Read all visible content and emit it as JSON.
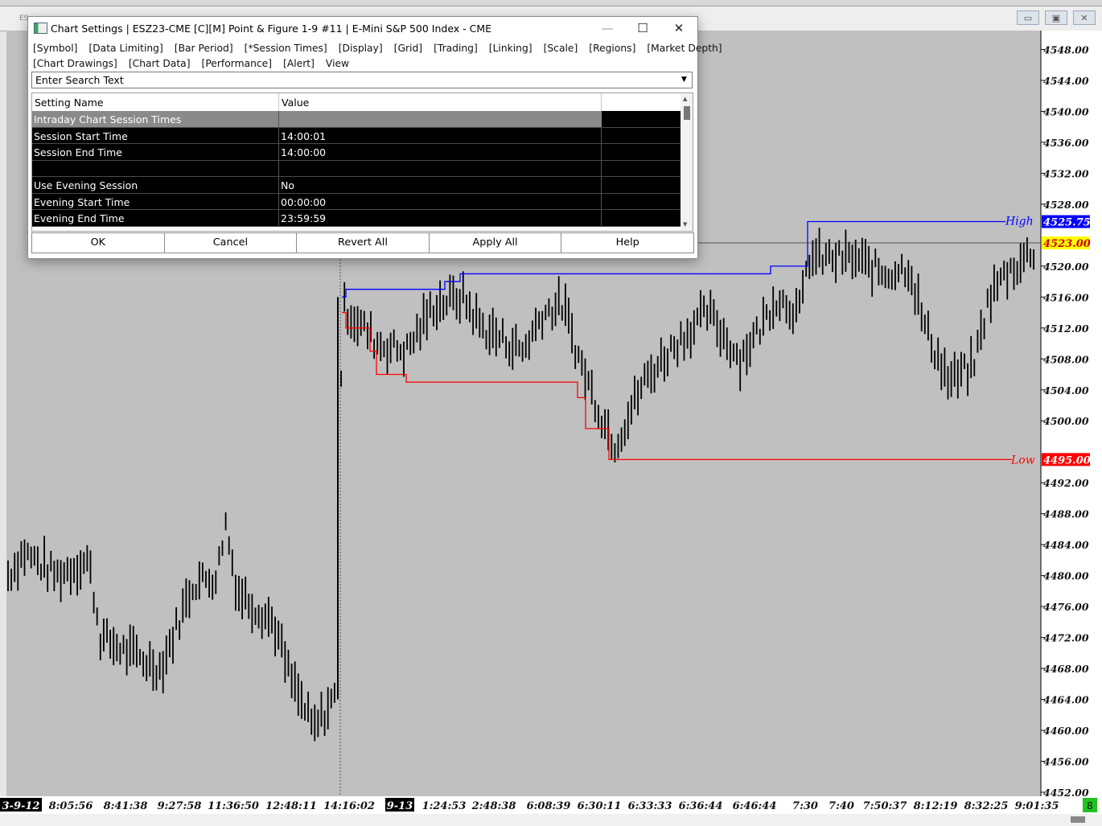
{
  "background_window": {
    "price_axis": [
      "4548.00",
      "4544.00",
      "4540.00",
      "4536.00",
      "4532.00",
      "4528.00",
      "4520.00",
      "4516.00",
      "4512.00",
      "4508.00",
      "4504.00",
      "4500.00",
      "4492.00",
      "4488.00",
      "4484.00",
      "4480.00",
      "4476.00",
      "4472.00",
      "4468.00",
      "4464.00",
      "4460.00",
      "4456.00",
      "4452.00"
    ],
    "high_label": "High",
    "high_value": "4525.75",
    "last_price": "4523.00",
    "low_label": "Low",
    "low_value": "4495.00",
    "high_color": "#0000ff",
    "low_color": "#ff0000",
    "last_color": "#ffff00",
    "time_axis": [
      {
        "text": "3-9-12",
        "boxed": true
      },
      {
        "text": "8:05:56",
        "boxed": false
      },
      {
        "text": "8:41:38",
        "boxed": false
      },
      {
        "text": "9:27:58",
        "boxed": false
      },
      {
        "text": "11:36:50",
        "boxed": false
      },
      {
        "text": "12:48:11",
        "boxed": false
      },
      {
        "text": "14:16:02",
        "boxed": false
      },
      {
        "text": "9-13",
        "boxed": true
      },
      {
        "text": "1:24:53",
        "boxed": false
      },
      {
        "text": "2:48:38",
        "boxed": false
      },
      {
        "text": "6:08:39",
        "boxed": false
      },
      {
        "text": "6:30:11",
        "boxed": false
      },
      {
        "text": "6:33:33",
        "boxed": false
      },
      {
        "text": "6:36:44",
        "boxed": false
      },
      {
        "text": "6:46:44",
        "boxed": false
      },
      {
        "text": "7:30",
        "boxed": false
      },
      {
        "text": "7:40",
        "boxed": false
      },
      {
        "text": "7:50:37",
        "boxed": false
      },
      {
        "text": "8:12:19",
        "boxed": false
      },
      {
        "text": "8:32:25",
        "boxed": false
      },
      {
        "text": "9:01:35",
        "boxed": false
      }
    ],
    "corner_badge": "8",
    "window_tab": "ES"
  },
  "dialog": {
    "title": "Chart Settings | ESZ23-CME [C][M]  Point & Figure 1-9 #11 | E-Mini S&P 500 Index - CME",
    "title_controls": {
      "minimize": "—",
      "maximize": "☐",
      "close": "✕"
    },
    "tabs_row1": [
      "[Symbol]",
      "[Data Limiting]",
      "[Bar Period]",
      "[*Session Times]",
      "[Display]",
      "[Grid]",
      "[Trading]",
      "[Linking]",
      "[Scale]",
      "[Regions]",
      "[Market Depth]"
    ],
    "tabs_row2": [
      "[Chart Drawings]",
      "[Chart Data]",
      "[Performance]",
      "[Alert]",
      "View"
    ],
    "search_value": "Enter Search Text",
    "columns": [
      "Setting Name",
      "Value",
      ""
    ],
    "rows": [
      {
        "name": "Intraday Chart Session Times",
        "value": "",
        "section": true
      },
      {
        "name": "Session Start Time",
        "value": "14:00:01"
      },
      {
        "name": "Session End Time",
        "value": "14:00:00"
      },
      {
        "name": "",
        "value": ""
      },
      {
        "name": "Use Evening Session",
        "value": "No"
      },
      {
        "name": "Evening Start Time",
        "value": "00:00:00"
      },
      {
        "name": "Evening End Time",
        "value": "23:59:59"
      }
    ],
    "buttons": [
      "OK",
      "Cancel",
      "Revert All",
      "Apply All",
      "Help"
    ]
  }
}
